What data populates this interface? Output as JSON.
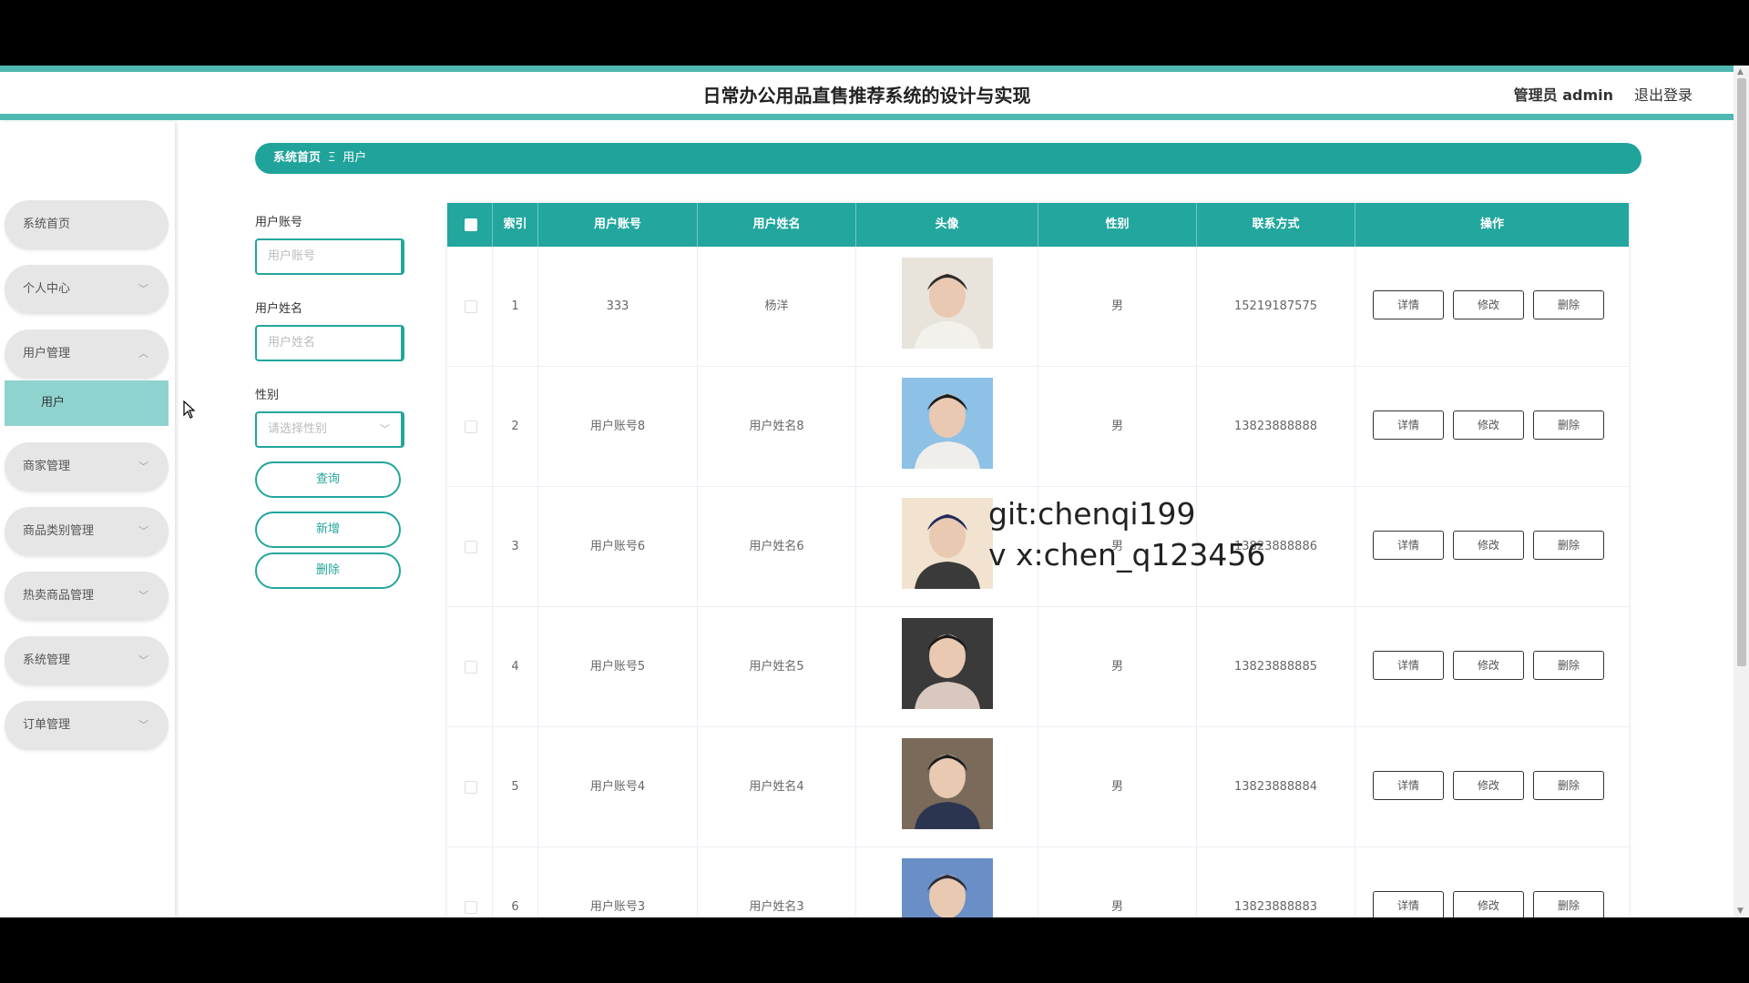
{
  "header": {
    "title": "日常办公用品直售推荐系统的设计与实现",
    "admin": "管理员 admin",
    "logout": "退出登录"
  },
  "sidebar": {
    "items": [
      {
        "label": "系统首页"
      },
      {
        "label": "个人中心"
      },
      {
        "label": "用户管理"
      },
      {
        "label": "用户"
      },
      {
        "label": "商家管理"
      },
      {
        "label": "商品类别管理"
      },
      {
        "label": "热卖商品管理"
      },
      {
        "label": "系统管理"
      },
      {
        "label": "订单管理"
      }
    ]
  },
  "breadcrumb": {
    "home": "系统首页",
    "separator": "Ξ",
    "current": "用户"
  },
  "filters": {
    "account_label": "用户账号",
    "account_placeholder": "用户账号",
    "name_label": "用户姓名",
    "name_placeholder": "用户姓名",
    "gender_label": "性别",
    "gender_placeholder": "请选择性别",
    "query_button": "查询",
    "add_button": "新增",
    "delete_button": "删除"
  },
  "table": {
    "columns": [
      "索引",
      "用户账号",
      "用户姓名",
      "头像",
      "性别",
      "联系方式",
      "操作"
    ],
    "rows": [
      {
        "index": "1",
        "account": "333",
        "name": "杨洋",
        "gender": "男",
        "phone": "15219187575"
      },
      {
        "index": "2",
        "account": "用户账号8",
        "name": "用户姓名8",
        "gender": "男",
        "phone": "13823888888"
      },
      {
        "index": "3",
        "account": "用户账号6",
        "name": "用户姓名6",
        "gender": "男",
        "phone": "13823888886"
      },
      {
        "index": "4",
        "account": "用户账号5",
        "name": "用户姓名5",
        "gender": "男",
        "phone": "13823888885"
      },
      {
        "index": "5",
        "account": "用户账号4",
        "name": "用户姓名4",
        "gender": "男",
        "phone": "13823888884"
      },
      {
        "index": "6",
        "account": "用户账号3",
        "name": "用户姓名3",
        "gender": "男",
        "phone": "13823888883"
      }
    ],
    "row_actions": {
      "detail": "详情",
      "edit": "修改",
      "delete": "删除"
    }
  },
  "watermark": {
    "line1": "git:chenqi199",
    "line2": "v x:chen_q123456"
  },
  "colors": {
    "accent": "#22a69d",
    "header_border": "#4fb8b1",
    "active_submenu": "#8fd3cf",
    "menu_bg": "#e6e6e6"
  }
}
